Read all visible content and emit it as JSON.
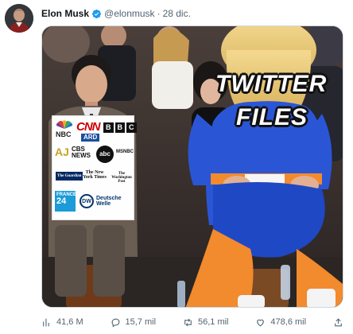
{
  "tweet": {
    "author": {
      "display_name": "Elon Musk",
      "handle": "@elonmusk",
      "verified": true,
      "verified_icon": "verified-badge-icon"
    },
    "separator": "·",
    "date": "28 dic.",
    "media": {
      "overlay_text": [
        "TWITTER",
        "FILES"
      ],
      "logo_labels": {
        "nbc": "NBC",
        "cnn": "CNN",
        "bbc": [
          "B",
          "B",
          "C"
        ],
        "ard": "ARD",
        "aj": "AJ",
        "cbs": "CBS",
        "cbs_news": "NEWS",
        "abc": "abc",
        "msnbc": "MSNBC",
        "guardian": "The Guardian",
        "nyt": "The New York Times",
        "wapo": "The Washington Post",
        "france24": [
          "FRANCE",
          "24"
        ],
        "dw": "DW",
        "dw_name": [
          "Deutsche",
          "Welle"
        ]
      }
    },
    "actions": {
      "views": {
        "icon": "views-icon",
        "count": "41,6 M"
      },
      "reply": {
        "icon": "reply-icon",
        "count": "15,7 mil"
      },
      "retweet": {
        "icon": "retweet-icon",
        "count": "56,1 mil"
      },
      "like": {
        "icon": "heart-icon",
        "count": "478,6 mil"
      },
      "share": {
        "icon": "share-icon"
      }
    },
    "colors": {
      "text_primary": "#0f1419",
      "text_secondary": "#536471",
      "verified": "#1d9bf0",
      "border": "#cfd9de",
      "overlay_text": "#ffffff",
      "jersey_blue": "#2a56d6",
      "jersey_orange": "#f28a2e"
    }
  }
}
